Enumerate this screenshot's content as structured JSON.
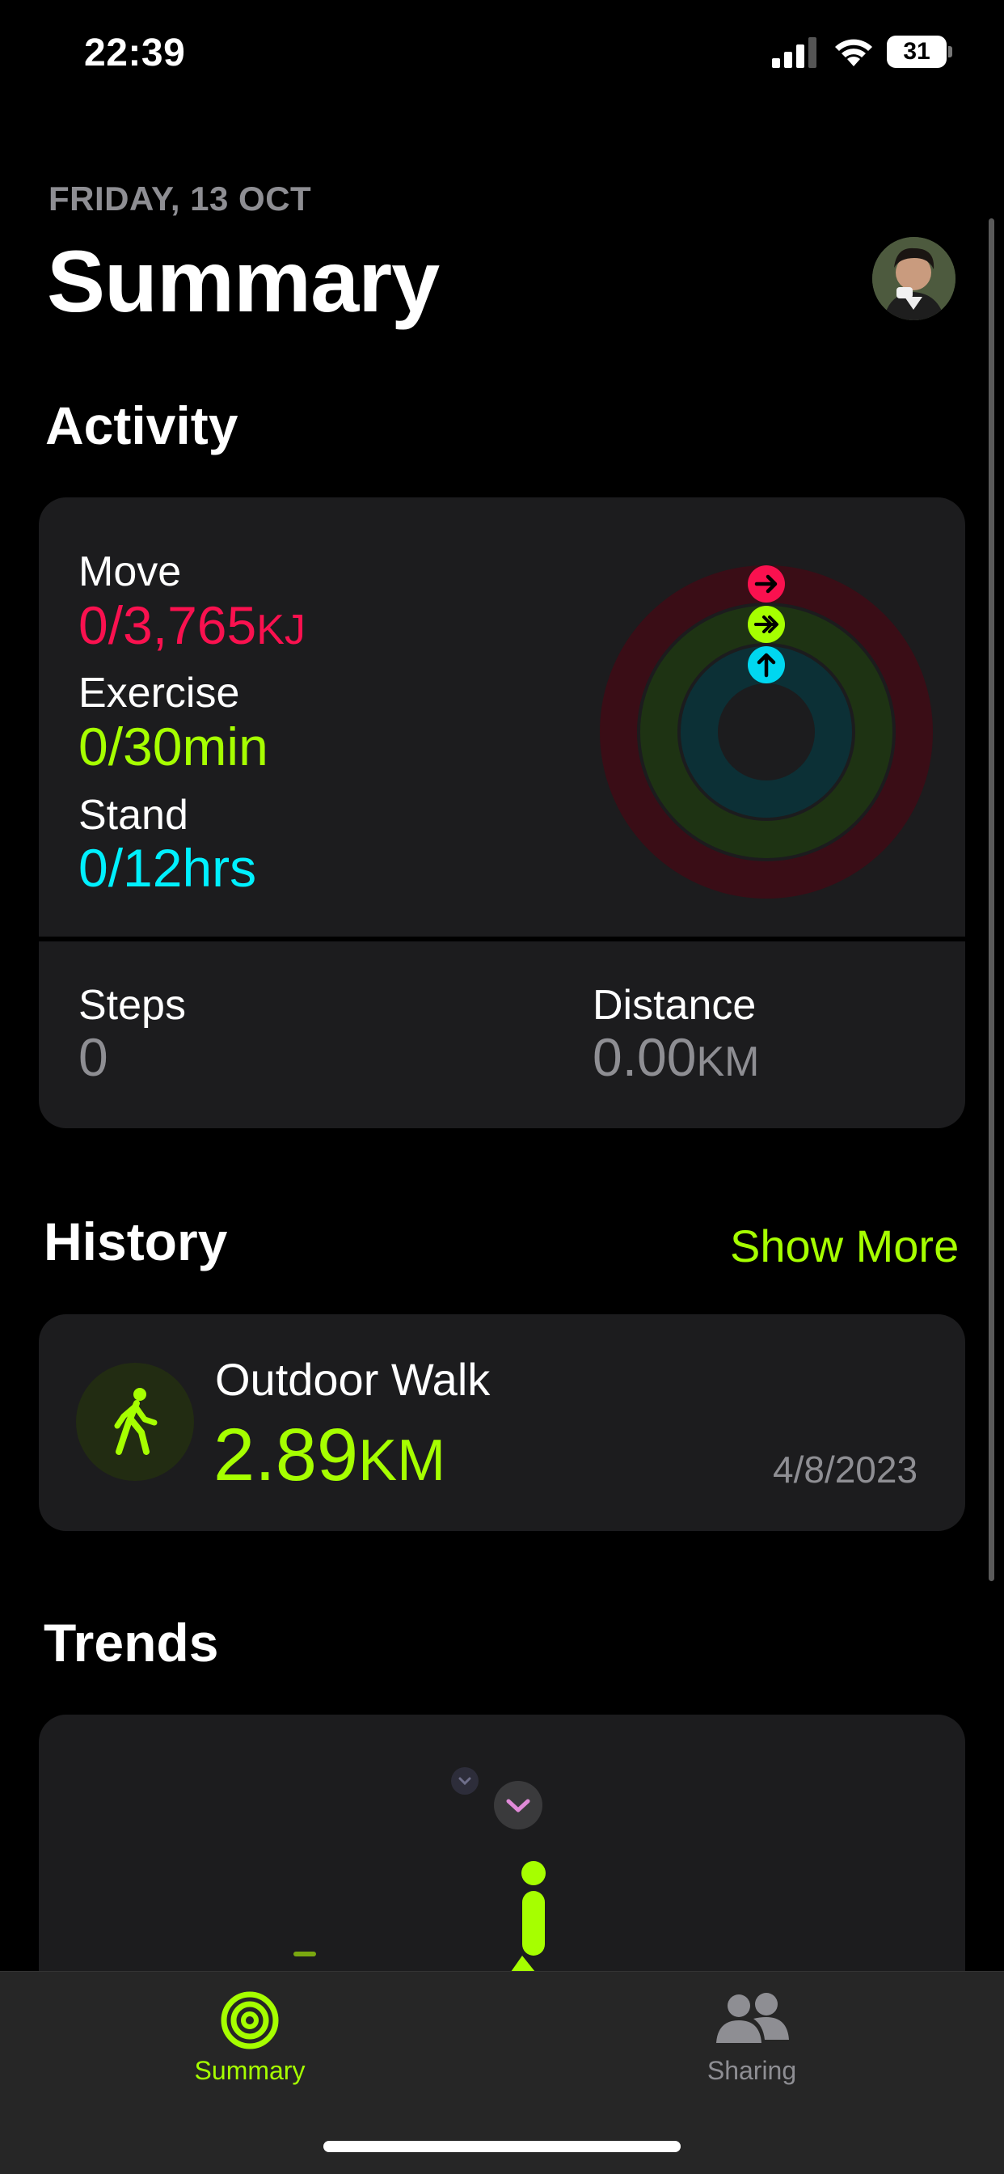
{
  "status_bar": {
    "time": "22:39",
    "battery": "31"
  },
  "header": {
    "date": "FRIDAY, 13 OCT",
    "title": "Summary"
  },
  "activity": {
    "section_title": "Activity",
    "move": {
      "label": "Move",
      "value": "0/3,765",
      "unit": "KJ",
      "color": "#fa114f"
    },
    "exercise": {
      "label": "Exercise",
      "value": "0/30min",
      "color": "#a6ff00"
    },
    "stand": {
      "label": "Stand",
      "value": "0/12hrs",
      "color": "#00f0ff"
    },
    "steps": {
      "label": "Steps",
      "value": "0"
    },
    "distance": {
      "label": "Distance",
      "value": "0.00",
      "unit": "KM"
    }
  },
  "history": {
    "section_title": "History",
    "show_more": "Show More",
    "workout": {
      "name": "Outdoor Walk",
      "distance": "2.89",
      "unit": "KM",
      "date": "4/8/2023",
      "icon": "walking-figure-icon"
    }
  },
  "trends": {
    "section_title": "Trends"
  },
  "tab_bar": {
    "tabs": [
      {
        "label": "Summary",
        "icon": "activity-rings-icon",
        "active": true
      },
      {
        "label": "Sharing",
        "icon": "people-icon",
        "active": false
      }
    ]
  },
  "colors": {
    "accent": "#a6ff00",
    "card": "#1c1c1e",
    "secondary_text": "#8e8e93"
  }
}
